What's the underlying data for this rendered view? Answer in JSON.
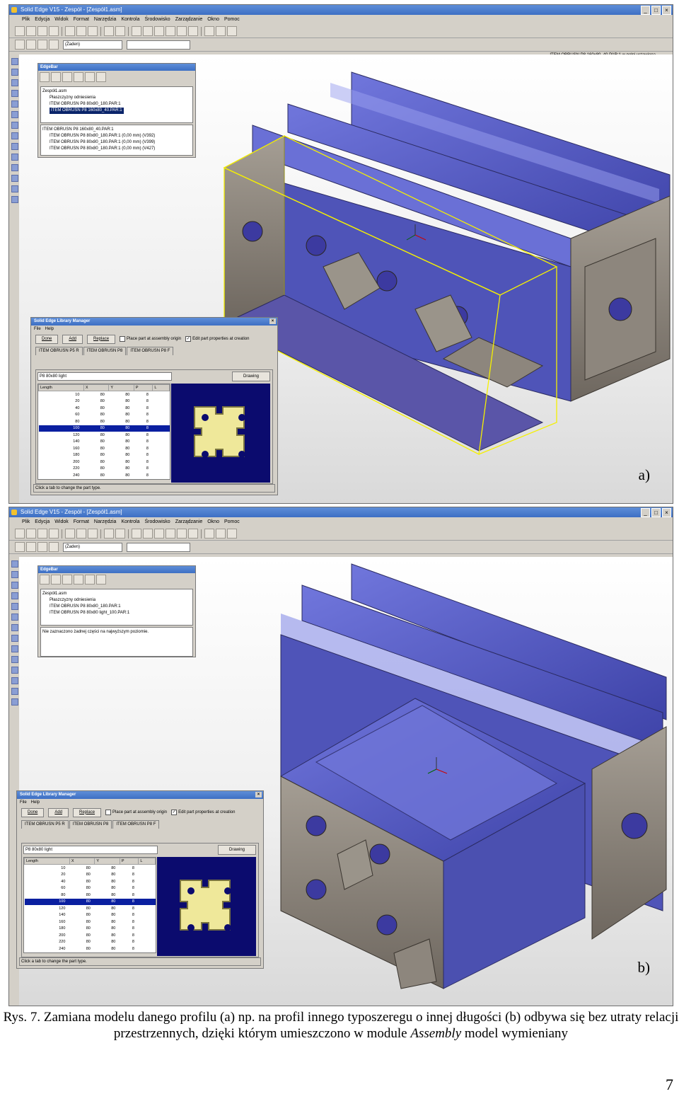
{
  "figure": {
    "caption_part1": "Rys. 7. Zamiana modelu danego profilu (a) np. na profil innego typoszeregu o innej długości (b) odbywa się bez utraty relacji przestrzennych, dzięki którym umieszczono w module ",
    "caption_italic": "Assembly",
    "caption_part2": " model wymieniany",
    "page_number": "7"
  },
  "menu_items": [
    "Plik",
    "Edycja",
    "Widok",
    "Format",
    "Narzędzia",
    "Kontrola",
    "Środowisko",
    "Zarządzanie",
    "Okno",
    "Pomoc"
  ],
  "icons": {
    "app": "solid-edge-app-icon",
    "minimize": "minimize-icon",
    "restore": "restore-icon",
    "close": "close-icon"
  },
  "colors": {
    "selection": "#0a246a",
    "highlight_box": "#f5f000",
    "profile_face": "#5b5fc4",
    "profile_metal": "#8c857c"
  },
  "panels": {
    "a": {
      "label": "a)",
      "window_title": "Solid Edge V15 - Zespół - [Zespół1.asm]",
      "layer_combo": "(Żaden)",
      "status_line": "ITEM OBRUSN P8 160x80_40.PAR:1 w pełni ustawiona",
      "edgebar": {
        "title": "EdgeBar",
        "tree": [
          {
            "text": "Zespół1.asm",
            "level": 0,
            "selected": false
          },
          {
            "text": "Płaszczyzny odniesienia",
            "level": 1,
            "selected": false
          },
          {
            "text": "ITEM OBRUSN P8 80x80_180.PAR:1",
            "level": 1,
            "selected": false
          },
          {
            "text": "ITEM OBRUSN P8 160x80_40.PAR:1",
            "level": 1,
            "selected": true
          }
        ],
        "relations_header": "ITEM OBRUSN P8 160x80_40.PAR:1",
        "relations": [
          "ITEM OBRUSN P8 80x80_180.PAR:1    (0,00 mm)   (V392)",
          "ITEM OBRUSN P8 80x80_180.PAR:1    (0,00 mm)   (V399)",
          "ITEM OBRUSN P8 80x80_180.PAR:1    (0,00 mm)   (V427)"
        ]
      }
    },
    "b": {
      "label": "b)",
      "window_title": "Solid Edge V15 - Zespół - [Zespół1.asm]",
      "layer_combo": "(Żaden)",
      "status_line": "",
      "edgebar": {
        "title": "EdgeBar",
        "tree": [
          {
            "text": "Zespół1.asm",
            "level": 0,
            "selected": false
          },
          {
            "text": "Płaszczyzny odniesienia",
            "level": 1,
            "selected": false
          },
          {
            "text": "ITEM OBRUSN P8 80x80_180.PAR:1",
            "level": 1,
            "selected": false
          },
          {
            "text": "ITEM OBRUSN P8 80x80 light_100.PAR:1",
            "level": 1,
            "selected": false
          }
        ],
        "info": "Nie zaznaczono żadnej części na najwyższym poziomie."
      }
    }
  },
  "library_manager": {
    "title": "Solid Edge Library Manager",
    "menu": [
      "File",
      "Help"
    ],
    "done_label": "Done",
    "add_label": "Add",
    "replace_label": "Replace",
    "place_origin_label": "Place part at assembly origin",
    "edit_props_label": "Edit part properties at creation",
    "tabs": [
      "ITEM OBRUSN P5 R",
      "ITEM OBRUSN P8",
      "ITEM OBRUSN P8 F"
    ],
    "profile_combo": "P8 80x80 light",
    "drawing_label": "Drawing",
    "columns": [
      "Length",
      "X",
      "Y",
      "P",
      "L"
    ],
    "rows": [
      [
        "10",
        "80",
        "80",
        "8"
      ],
      [
        "20",
        "80",
        "80",
        "8"
      ],
      [
        "40",
        "80",
        "80",
        "8"
      ],
      [
        "60",
        "80",
        "80",
        "8"
      ],
      [
        "80",
        "80",
        "80",
        "8"
      ],
      [
        "100",
        "80",
        "80",
        "8"
      ],
      [
        "120",
        "80",
        "80",
        "8"
      ],
      [
        "140",
        "80",
        "80",
        "8"
      ],
      [
        "160",
        "80",
        "80",
        "8"
      ],
      [
        "180",
        "80",
        "80",
        "8"
      ],
      [
        "200",
        "80",
        "80",
        "8"
      ],
      [
        "220",
        "80",
        "80",
        "8"
      ],
      [
        "240",
        "80",
        "80",
        "8"
      ]
    ],
    "selected_length": "100",
    "status": "Click a tab to change the part type."
  }
}
